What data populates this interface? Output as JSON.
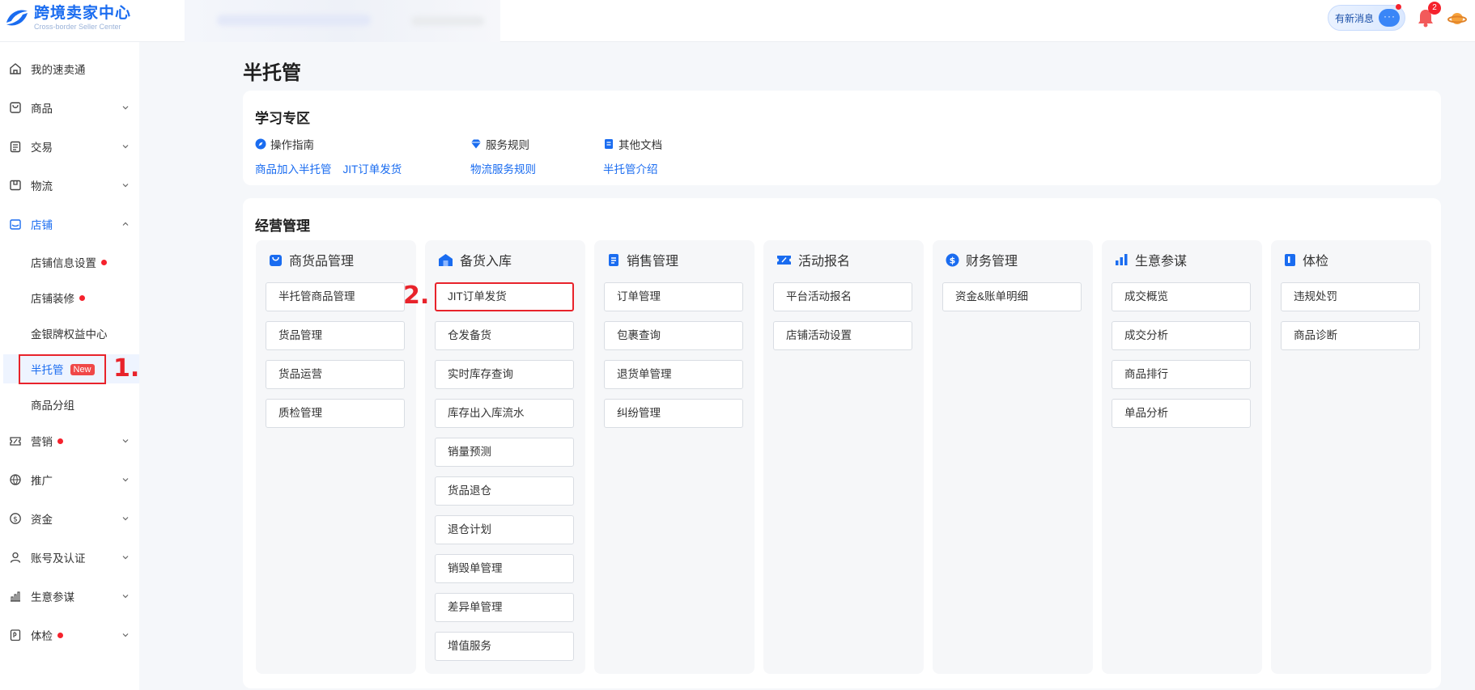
{
  "header": {
    "logo_title": "跨境卖家中心",
    "logo_sub": "Cross-border Seller Center",
    "new_message": "有新消息",
    "bell_count": "2"
  },
  "sidebar": {
    "items": [
      {
        "label": "我的速卖通"
      },
      {
        "label": "商品"
      },
      {
        "label": "交易"
      },
      {
        "label": "物流"
      },
      {
        "label": "店铺"
      },
      {
        "label": "营销"
      },
      {
        "label": "推广"
      },
      {
        "label": "资金"
      },
      {
        "label": "账号及认证"
      },
      {
        "label": "生意参谋"
      },
      {
        "label": "体检"
      }
    ],
    "store_sub": [
      {
        "label": "店铺信息设置"
      },
      {
        "label": "店铺装修"
      },
      {
        "label": "金银牌权益中心"
      },
      {
        "label": "半托管",
        "badge": "New"
      },
      {
        "label": "商品分组"
      }
    ]
  },
  "annotations": {
    "step1": "1.",
    "step2": "2."
  },
  "main": {
    "title": "半托管",
    "learn": {
      "title": "学习专区",
      "sections": [
        {
          "head": "操作指南",
          "links": [
            "商品加入半托管",
            "JIT订单发货"
          ]
        },
        {
          "head": "服务规则",
          "links": [
            "物流服务规则"
          ]
        },
        {
          "head": "其他文档",
          "links": [
            "半托管介绍"
          ]
        }
      ]
    },
    "ops": {
      "title": "经营管理",
      "groups": [
        {
          "title": "商货品管理",
          "items": [
            "半托管商品管理",
            "货品管理",
            "货品运营",
            "质检管理"
          ]
        },
        {
          "title": "备货入库",
          "items": [
            "JIT订单发货",
            "仓发备货",
            "实时库存查询",
            "库存出入库流水",
            "销量预测",
            "货品退仓",
            "退仓计划",
            "销毁单管理",
            "差异单管理",
            "增值服务"
          ]
        },
        {
          "title": "销售管理",
          "items": [
            "订单管理",
            "包裹查询",
            "退货单管理",
            "纠纷管理"
          ]
        },
        {
          "title": "活动报名",
          "items": [
            "平台活动报名",
            "店铺活动设置"
          ]
        },
        {
          "title": "财务管理",
          "items": [
            "资金&账单明细"
          ]
        },
        {
          "title": "生意参谋",
          "items": [
            "成交概览",
            "成交分析",
            "商品排行",
            "单品分析"
          ]
        },
        {
          "title": "体检",
          "items": [
            "违规处罚",
            "商品诊断"
          ]
        }
      ]
    }
  }
}
